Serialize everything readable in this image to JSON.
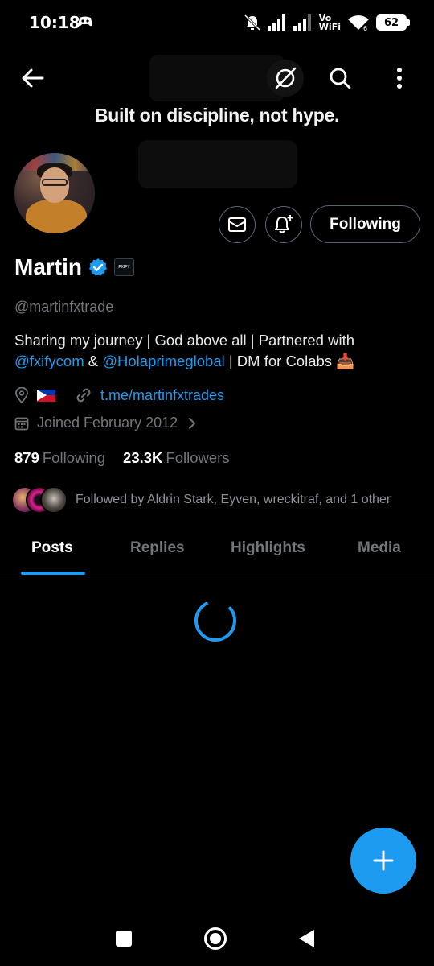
{
  "status_bar": {
    "time": "10:18",
    "vo": "Vo",
    "wifi_label": "WiFi",
    "wifi_sub": "6",
    "battery": "62"
  },
  "banner": {
    "text": "Built on discipline, not hype."
  },
  "profile": {
    "name": "Martin",
    "affiliate_badge": "FXIFY",
    "handle": "@martinfxtrade",
    "bio_line1": "Sharing my journey | God above all | Partnered with",
    "bio_mention1": "@fxifycom",
    "bio_amp": " & ",
    "bio_mention2": "@Holaprimeglobal",
    "bio_tail": " | DM for Colabs 📥",
    "website": "t.me/martinfxtrades",
    "joined": "Joined February 2012",
    "following_count": "879",
    "following_label": "Following",
    "followers_count": "23.3K",
    "followers_label": "Followers",
    "followed_by": "Followed by Aldrin Stark, Eyven, wreckitraf, and 1 other"
  },
  "actions": {
    "following_button": "Following"
  },
  "tabs": [
    "Posts",
    "Replies",
    "Highlights",
    "Media"
  ],
  "colors": {
    "accent": "#1d9bf0",
    "background": "#000000",
    "muted": "#71767b"
  },
  "icons": [
    "back-arrow-icon",
    "grok-icon",
    "search-icon",
    "more-icon",
    "mail-icon",
    "bell-plus-icon",
    "verified-icon",
    "location-icon",
    "link-icon",
    "calendar-icon",
    "chevron-right-icon",
    "plus-icon"
  ]
}
